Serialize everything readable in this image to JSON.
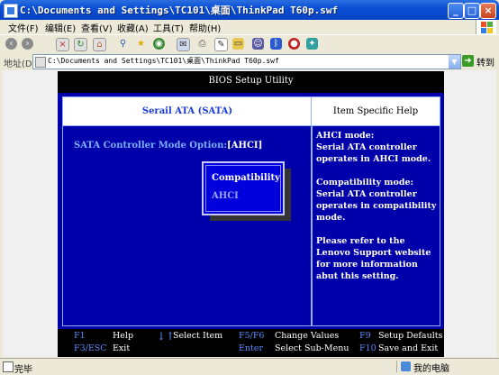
{
  "window": {
    "title": "C:\\Documents and Settings\\TC101\\桌面\\ThinkPad T60p.swf",
    "minimize": "_",
    "maximize": "□",
    "close": "×"
  },
  "menu": {
    "items": [
      "文件(F)",
      "编辑(E)",
      "查看(V)",
      "收藏(A)",
      "工具(T)",
      "帮助(H)"
    ]
  },
  "address": {
    "label": "地址(D)",
    "value": "C:\\Documents and Settings\\TC101\\桌面\\ThinkPad T60p.swf",
    "go_label": "转到"
  },
  "bios": {
    "header": "BIOS Setup Utility",
    "main_title": "Serail ATA (SATA)",
    "help_title": "Item Specific Help",
    "option_label": "SATA Controller Mode Option:",
    "option_value": "[AHCI]",
    "popup_options": [
      "Compatibility",
      "AHCI"
    ],
    "help_paragraphs": [
      "AHCI mode:\nSerial ATA controller operates in AHCI mode.",
      "Compatibility mode:\nSerial ATA controller operates in compatibility mode.",
      "Please refer to the Lenovo Support website for more information abut this setting."
    ],
    "footer": {
      "f1_key": "F1",
      "f1_desc": "Help",
      "updown_key": "↓↑",
      "updown_desc": "Select Item",
      "f5f6_key": "F5/F6",
      "f5f6_desc": "Change Values",
      "f9_key": "F9",
      "f9_desc": "Setup Defaults",
      "f3_key": "F3/ESC",
      "f3_desc": "Exit",
      "enter_key": "Enter",
      "enter_desc": "Select Sub-Menu",
      "f10_key": "F10",
      "f10_desc": "Save and Exit"
    }
  },
  "status": {
    "text": "完毕",
    "zone": "我的电脑"
  },
  "colors": {
    "bios_blue": "#0000aa",
    "title_blue": "#0a4fd6",
    "key_blue": "#5c8cff"
  }
}
